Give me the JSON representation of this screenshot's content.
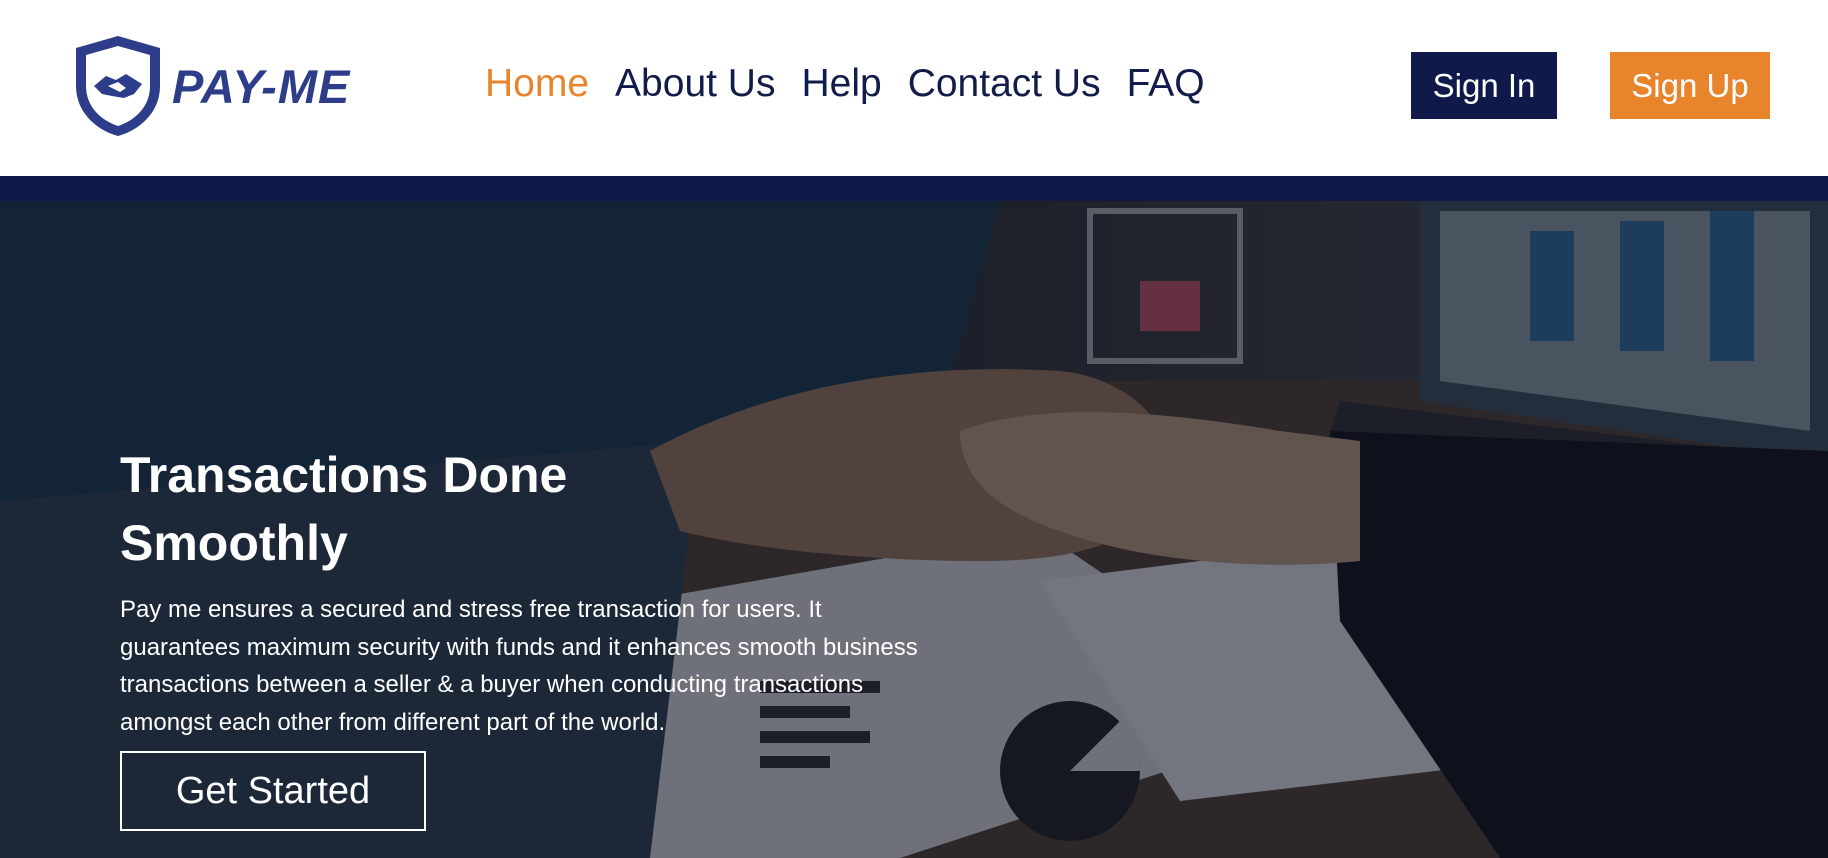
{
  "brand": {
    "name": "PAY-ME",
    "logo_icon": "shield-handshake-icon",
    "colors": {
      "navy": "#0f1a4a",
      "orange": "#e8842b",
      "logo_blue": "#2d3d8a"
    }
  },
  "nav": {
    "items": [
      {
        "label": "Home",
        "active": true
      },
      {
        "label": "About Us",
        "active": false
      },
      {
        "label": "Help",
        "active": false
      },
      {
        "label": "Contact Us",
        "active": false
      },
      {
        "label": "FAQ",
        "active": false
      }
    ]
  },
  "auth": {
    "sign_in": "Sign In",
    "sign_up": "Sign Up"
  },
  "hero": {
    "title_line1": "Transactions Done",
    "title_line2": "Smoothly",
    "description_lines": [
      "Pay me ensures a secured and stress free transaction for users. It",
      "guarantees maximum security with funds and it enhances smooth business",
      "transactions between a seller & a buyer when conducting transactions",
      "amongst each other from different part of the world."
    ],
    "cta": "Get Started"
  }
}
